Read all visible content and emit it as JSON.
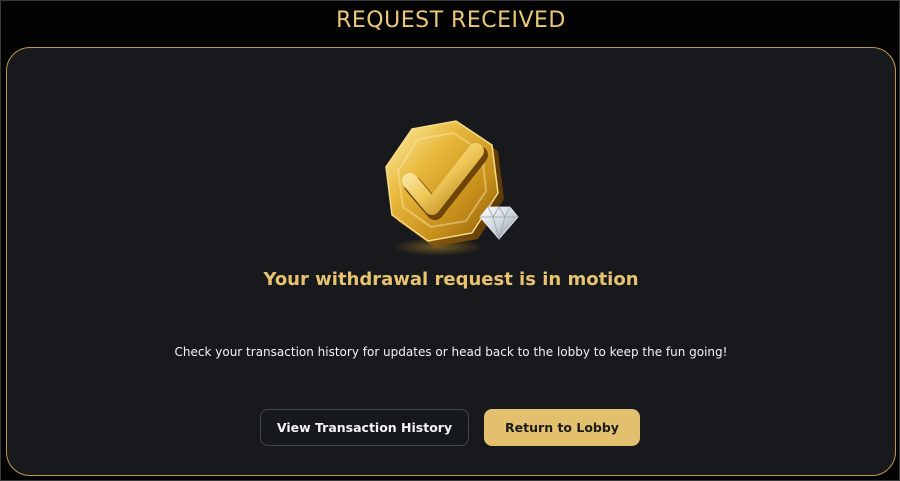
{
  "header": {
    "title": "REQUEST RECEIVED"
  },
  "main": {
    "emblem_icon": "gold-octagon-checkmark-with-diamond",
    "headline": "Your withdrawal request is in motion",
    "message": "Check your transaction history for updates or head back to the lobby to keep the fun going!"
  },
  "actions": {
    "history_label": "View Transaction History",
    "lobby_label": "Return to Lobby"
  },
  "colors": {
    "accent_gold": "#e2c06d",
    "panel_bg": "#18191c",
    "page_bg": "#030303",
    "border_gold": "#b99a52"
  }
}
